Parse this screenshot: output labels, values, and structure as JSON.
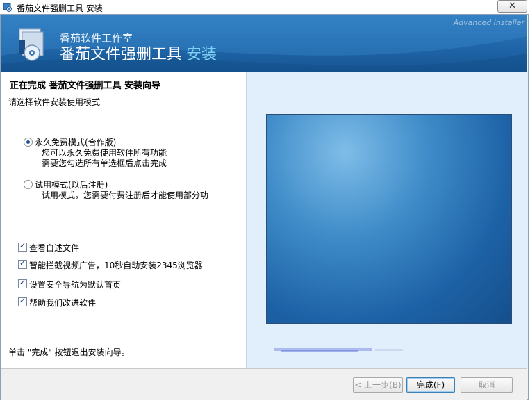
{
  "window": {
    "title": "番茄文件强删工具 安装",
    "close_symbol": "✕"
  },
  "banner": {
    "studio": "番茄软件工作室",
    "product": "番茄文件强删工具",
    "install": "安装",
    "watermark": "Advanced Installer"
  },
  "main": {
    "heading": "正在完成 番茄文件强删工具 安装向导",
    "subheading": "请选择软件安装使用模式",
    "options": [
      {
        "label": "永久免费模式(合作版)",
        "desc1": "您可以永久免费使用软件所有功能",
        "desc2": "需要您勾选所有单选框后点击完成",
        "checked": true
      },
      {
        "label": "试用模式(以后注册)",
        "desc1": "试用模式，您需要付费注册后才能使用部分功",
        "desc2": "",
        "checked": false
      }
    ],
    "checkboxes": [
      {
        "label": "查看自述文件",
        "checked": true
      },
      {
        "label": "智能拦截视频广告，10秒自动安装2345浏览器",
        "checked": true
      },
      {
        "label": "设置安全导航为默认首页",
        "checked": true
      },
      {
        "label": "帮助我们改进软件",
        "checked": true
      }
    ],
    "footer": "单击 \"完成\" 按钮退出安装向导。"
  },
  "buttons": {
    "back": "< 上一步(B)",
    "finish": "完成(F)",
    "cancel": "取消"
  },
  "colors": {
    "banner": "#1f66a9",
    "accent_text": "#7fd0f5",
    "right_panel": "#e0effb"
  }
}
